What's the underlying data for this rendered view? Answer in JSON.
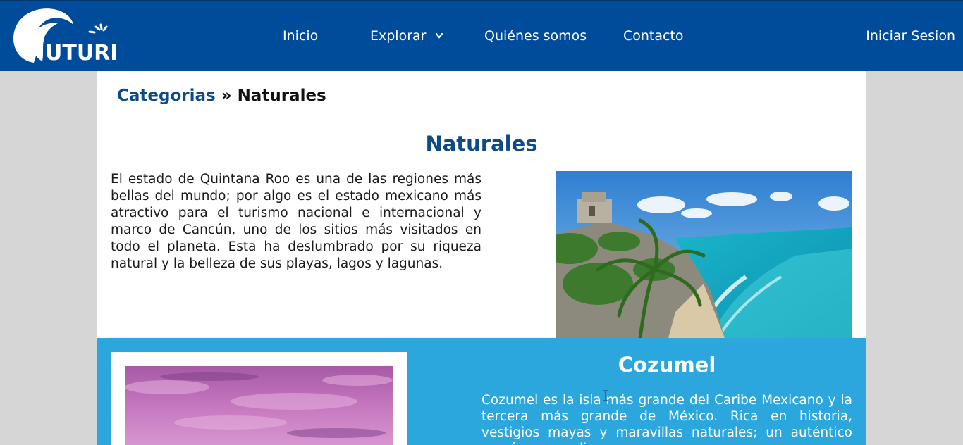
{
  "brand": {
    "logo_text": "UTURI",
    "colors": {
      "nav": "#014c9a",
      "accent": "#0e4a86",
      "band": "#2ba7de"
    }
  },
  "nav": {
    "items": [
      {
        "label": "Inicio"
      },
      {
        "label": "Explorar",
        "icon": "chevron-down-icon"
      },
      {
        "label": "Quiénes somos"
      },
      {
        "label": "Contacto"
      }
    ],
    "login": "Iniciar Sesion"
  },
  "breadcrumb": {
    "parent": "Categorias",
    "separator": "»",
    "current": "Naturales"
  },
  "section": {
    "title": "Naturales",
    "text": "El estado de Quintana Roo es una de las regiones más bellas del mundo; por algo es el estado mexicano más atractivo para el turismo nacional e internacional y marco de Cancún, uno de los sitios más visitados en todo el planeta. Esta ha deslumbrado por su riqueza natural y la belleza de sus playas, lagos y lagunas.",
    "image": "tulum-coast-photo"
  },
  "feature": {
    "title": "Cozumel",
    "text": "Cozumel es la isla más grande del Caribe Mexicano y la tercera más grande de México. Rica en historia, vestigios mayas y maravillas naturales; un auténtico paraíso en medio",
    "image": "cozumel-sunset-photo"
  }
}
